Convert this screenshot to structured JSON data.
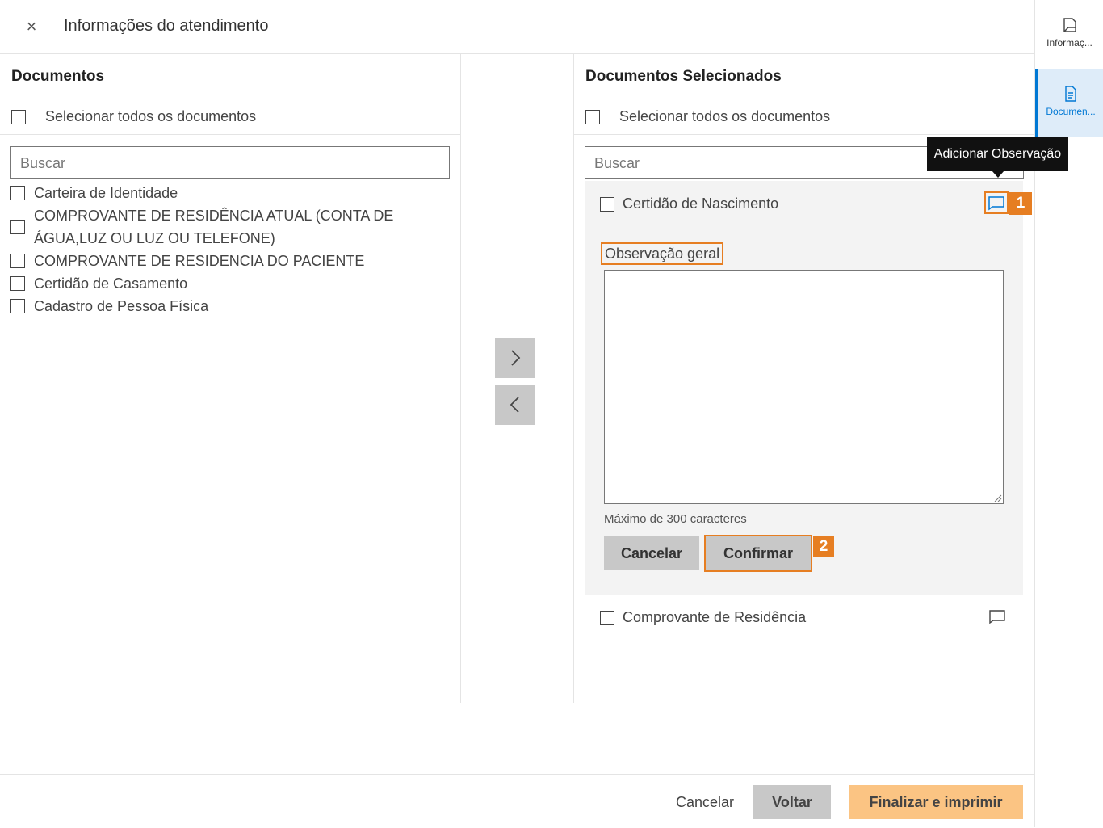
{
  "header": {
    "close_glyph": "×",
    "title": "Informações do atendimento"
  },
  "rail": {
    "items": [
      {
        "label": "Informaç...",
        "icon": "info-doc-icon",
        "active": false
      },
      {
        "label": "Documen...",
        "icon": "document-icon",
        "active": true
      }
    ]
  },
  "left": {
    "title": "Documentos",
    "select_all": "Selecionar todos os documentos",
    "search_placeholder": "Buscar",
    "items": [
      {
        "label": "Carteira de Identidade"
      },
      {
        "label_line1": "COMPROVANTE DE RESIDÊNCIA ATUAL (CONTA DE",
        "label_line2": "ÁGUA,LUZ OU LUZ OU TELEFONE)"
      },
      {
        "label": "COMPROVANTE DE RESIDENCIA DO PACIENTE"
      },
      {
        "label": "Certidão de Casamento"
      },
      {
        "label": "Cadastro de Pessoa Física"
      }
    ]
  },
  "transfer": {
    "move_right": "chevron-right-icon",
    "move_left": "chevron-left-icon"
  },
  "right": {
    "title": "Documentos Selecionados",
    "select_all": "Selecionar todos os documentos",
    "search_placeholder": "Buscar",
    "tooltip": "Adicionar Observação",
    "items": [
      {
        "label": "Certidão de Nascimento",
        "badge": "1",
        "observation": {
          "label": "Observação geral",
          "value": "",
          "hint": "Máximo de 300 caracteres",
          "cancel": "Cancelar",
          "confirm": "Confirmar",
          "confirm_badge": "2"
        }
      },
      {
        "label": "Comprovante de Residência"
      }
    ]
  },
  "footer": {
    "cancel": "Cancelar",
    "back": "Voltar",
    "finish": "Finalizar e imprimir"
  },
  "colors": {
    "accent": "#0078d4",
    "highlight": "#e67e22",
    "primary_button": "#fbc483",
    "secondary_button": "#c8c8c8"
  }
}
